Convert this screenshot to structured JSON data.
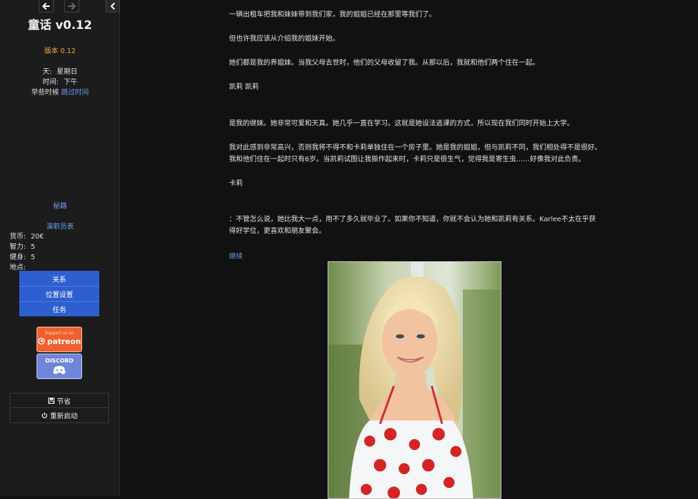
{
  "sidebar": {
    "title": "童话 v0.12",
    "version": "版本 0.12",
    "day_label": "天:",
    "day_value": "星期日",
    "time_label": "时间:",
    "time_value": "下午",
    "later_text": "早些时候",
    "skip_time_link": "跳过时间",
    "cheats_link": "秘籍",
    "cast_link": "演职员表",
    "stats": [
      {
        "label": "货币:",
        "value": "20€"
      },
      {
        "label": "智力:",
        "value": "5"
      },
      {
        "label": "健身:",
        "value": "5"
      },
      {
        "label": "地点:",
        "value": ""
      }
    ],
    "menu": {
      "relations": "关系",
      "location_settings": "位置设置",
      "tasks": "任务"
    },
    "patreon": {
      "tagline": "Support us on",
      "name": "patreon"
    },
    "discord": {
      "name": "DISCORD"
    },
    "save_label": "节省",
    "restart_label": "重新启动"
  },
  "story": {
    "paragraphs": [
      "一辆出租车把我和妹妹带到我们家，我的姐姐已经在那里等我们了。",
      "但也许我应该从介绍我的姐妹开始。",
      "她们都是我的养姐妹。当我父母去世时，他们的父母收留了我。从那以后，我就和他们两个住在一起。",
      "凯莉 凯莉",
      "是我的继妹。她非常可爱和天真。她几乎一直在学习。这就是她设法逃课的方式，所以现在我们同时开始上大学。",
      "我对此感到非常高兴，否则我将不得不和卡莉单独住在一个房子里。她是我的姐姐，但与凯莉不同，我们相处得不是很好。我和他们住在一起时只有6岁。当凯莉试图让我振作起来时，卡莉只是很生气，觉得我是寄生虫……好像我对此负责。",
      "卡莉",
      "：不管怎么说，她比我大一点，用不了多久就毕业了。如果你不知道，你就不会认为她和凯莉有关系。Karlee不太在乎获得好学位，更喜欢和朋友聚会。"
    ],
    "continue_link": "继续"
  },
  "icons": {
    "back": "arrow-left-icon",
    "forward": "arrow-right-icon",
    "collapse": "chevron-left-icon",
    "save": "floppy-disk-icon",
    "restart": "power-icon"
  },
  "colors": {
    "accent": "#2d5fd0",
    "link": "#6b9ef0",
    "version": "#e8b23c",
    "patreon": "#f0602e",
    "discord": "#6f85d9"
  }
}
